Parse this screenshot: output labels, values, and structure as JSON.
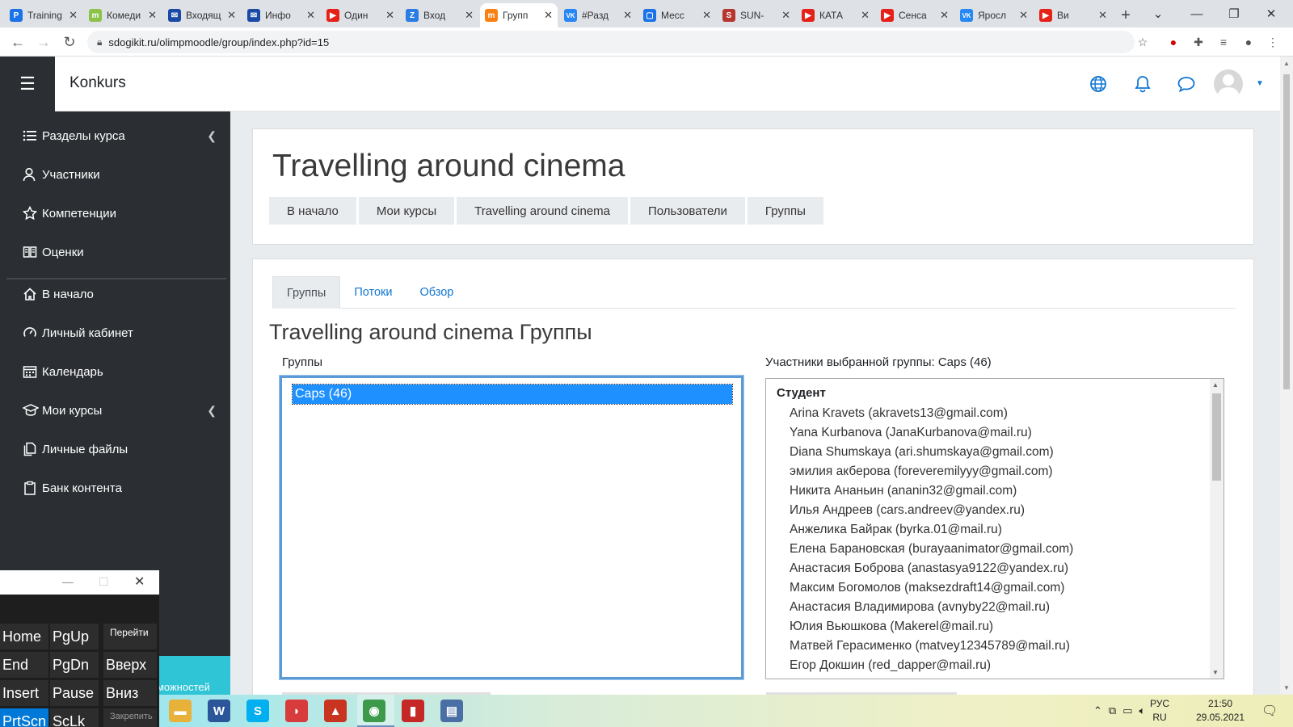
{
  "browser": {
    "tabs": [
      {
        "label": "Training",
        "favicon": "P",
        "color": "#1a73e8",
        "active": false
      },
      {
        "label": "Комеди",
        "favicon": "m",
        "color": "#8bc34a",
        "active": false
      },
      {
        "label": "Входящ",
        "favicon": "✉",
        "color": "#1a4aa6",
        "active": false
      },
      {
        "label": "Инфо",
        "favicon": "✉",
        "color": "#1a4aa6",
        "active": false
      },
      {
        "label": "Один",
        "favicon": "▶",
        "color": "#e62117",
        "active": false
      },
      {
        "label": "Вход",
        "favicon": "Z",
        "color": "#2a7de1",
        "active": false
      },
      {
        "label": "Групп",
        "favicon": "m",
        "color": "#f98012",
        "active": true
      },
      {
        "label": "#Разд",
        "favicon": "VK",
        "color": "#2787f5",
        "active": false
      },
      {
        "label": "Месс",
        "favicon": "▢",
        "color": "#1a73e8",
        "active": false
      },
      {
        "label": "SUN-",
        "favicon": "S",
        "color": "#b5372d",
        "active": false
      },
      {
        "label": "КАТА",
        "favicon": "▶",
        "color": "#e62117",
        "active": false
      },
      {
        "label": "Сенса",
        "favicon": "▶",
        "color": "#e62117",
        "active": false
      },
      {
        "label": "Яросл",
        "favicon": "VK",
        "color": "#2787f5",
        "active": false
      },
      {
        "label": "Ви",
        "favicon": "▶",
        "color": "#e62117",
        "active": false
      }
    ],
    "url": "sdogikit.ru/olimpmoodle/group/index.php?id=15"
  },
  "navbar": {
    "site_name": "Konkurs",
    "accent": "#1177d1"
  },
  "drawer": {
    "items": [
      {
        "label": "Разделы курса",
        "icon": "list-icon",
        "caret": true
      },
      {
        "label": "Участники",
        "icon": "users-icon",
        "caret": false
      },
      {
        "label": "Компетенции",
        "icon": "star-icon",
        "caret": false
      },
      {
        "label": "Оценки",
        "icon": "grades-book-icon",
        "caret": false
      },
      {
        "label": "В начало",
        "icon": "home-icon",
        "caret": false
      },
      {
        "label": "Личный кабинет",
        "icon": "dashboard-icon",
        "caret": false
      },
      {
        "label": "Календарь",
        "icon": "calendar-icon",
        "caret": false
      },
      {
        "label": "Мои курсы",
        "icon": "graduation-cap-icon",
        "caret": true
      },
      {
        "label": "Личные файлы",
        "icon": "files-icon",
        "caret": false
      },
      {
        "label": "Банк контента",
        "icon": "clipboard-icon",
        "caret": false
      }
    ],
    "teal_fragment": "зможностей"
  },
  "page": {
    "title": "Travelling around cinema",
    "breadcrumb": [
      "В начало",
      "Мои курсы",
      "Travelling around cinema",
      "Пользователи",
      "Группы"
    ],
    "tabs": [
      {
        "label": "Группы",
        "active": true
      },
      {
        "label": "Потоки",
        "active": false
      },
      {
        "label": "Обзор",
        "active": false
      }
    ],
    "section_heading": "Travelling around cinema Группы",
    "groups_label": "Группы",
    "groups": [
      "Caps (46)"
    ],
    "members_label": "Участники выбранной группы: Caps (46)",
    "members_role": "Студент",
    "members": [
      "Arina Kravets (akravets13@gmail.com)",
      "Yana Kurbanova (JanaKurbanova@mail.ru)",
      "Diana Shumskaya (ari.shumskaya@gmail.com)",
      "эмилия акберова (foreveremilyyy@gmail.com)",
      "Никита Ананьин (ananin32@gmail.com)",
      "Илья Андреев (cars.andreev@yandex.ru)",
      "Анжелика Байрак (byrka.01@mail.ru)",
      "Елена Барановская (burayaanimator@gmail.com)",
      "Анастасия Боброва (anastasya9122@yandex.ru)",
      "Максим Богомолов (maksezdraft14@gmail.com)",
      "Анастасия Владимирова (avnyby22@mail.ru)",
      "Юлия Вьюшкова (Makerel@mail.ru)",
      "Матвей Герасименко (matvey12345789@mail.ru)",
      "Егор Докшин (red_dapper@mail.ru)"
    ]
  },
  "osk": {
    "keys": [
      {
        "label": "Home",
        "small": false,
        "highlight": false
      },
      {
        "label": "PgUp",
        "small": false,
        "highlight": false
      },
      {
        "label": "Перейти",
        "small": true,
        "highlight": false
      },
      {
        "label": "End",
        "small": false,
        "highlight": false
      },
      {
        "label": "PgDn",
        "small": false,
        "highlight": false
      },
      {
        "label": "Вверх",
        "small": false,
        "highlight": false
      },
      {
        "label": "Insert",
        "small": false,
        "highlight": false
      },
      {
        "label": "Pause",
        "small": false,
        "highlight": false
      },
      {
        "label": "Вниз",
        "small": false,
        "highlight": false
      },
      {
        "label": "PrtScn",
        "small": false,
        "highlight": true
      },
      {
        "label": "ScLk",
        "small": false,
        "highlight": false
      },
      {
        "label": "Закрепить",
        "small": true,
        "highlight": false
      }
    ]
  },
  "taskbar": {
    "apps": [
      {
        "name": "file-explorer-icon",
        "glyph": "▬",
        "color": "#e8b23a"
      },
      {
        "name": "word-icon",
        "glyph": "W",
        "color": "#2b579a"
      },
      {
        "name": "skype-icon",
        "glyph": "S",
        "color": "#00aff0"
      },
      {
        "name": "reader-icon",
        "glyph": "◗",
        "color": "#d83b3b"
      },
      {
        "name": "pdf-icon",
        "glyph": "▲",
        "color": "#c8341f"
      },
      {
        "name": "chrome-icon",
        "glyph": "◉",
        "color": "#3c9a4a"
      },
      {
        "name": "book-icon",
        "glyph": "▮",
        "color": "#c62828"
      },
      {
        "name": "printer-app-icon",
        "glyph": "▤",
        "color": "#4a6fa5"
      }
    ],
    "lang": "РУС",
    "lang_sub": "RU",
    "time": "21:50",
    "date": "29.05.2021"
  }
}
